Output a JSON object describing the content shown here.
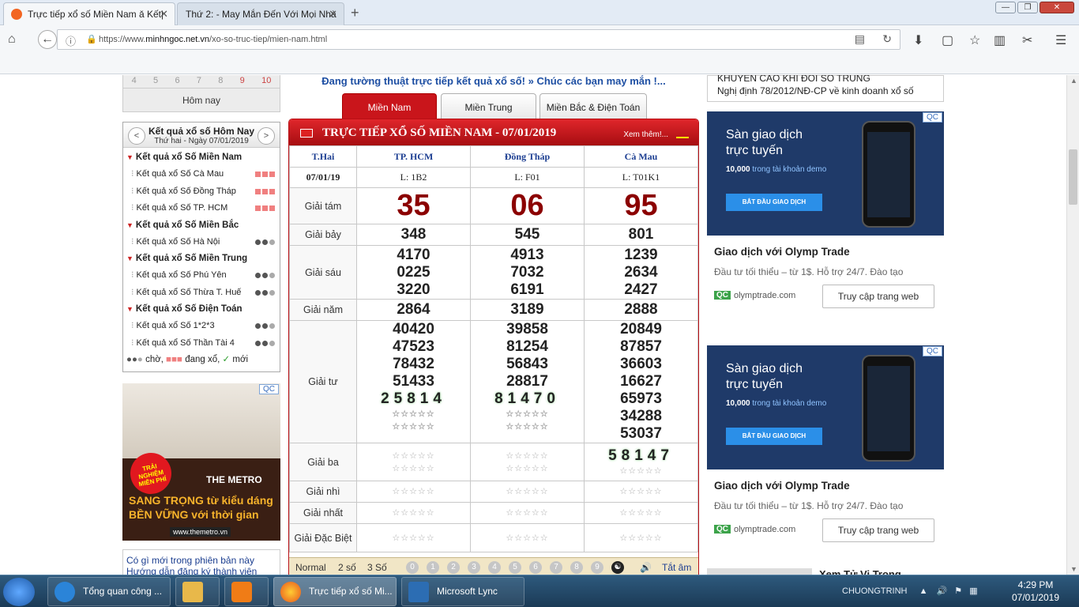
{
  "browser": {
    "tabs": [
      {
        "title": "Trực tiếp xổ số Miền Nam ǎ Kết|",
        "active": true
      },
      {
        "title": "Thứ 2: - May Mắn Đến Với Mọi Nhà",
        "active": false
      }
    ],
    "url_prefix": "https://www.",
    "url_domain": "minhngoc.net.vn",
    "url_path": "/xo-so-truc-tiep/mien-nam.html"
  },
  "left": {
    "calendar_row": [
      "4",
      "5",
      "6",
      "7",
      "8",
      "9",
      "10"
    ],
    "today_label": "Hôm nay",
    "results_title": "Kết quả xổ số Hôm Nay",
    "results_date": "Thứ hai - Ngày 07/01/2019",
    "groups": [
      {
        "title": "Kết quả xổ Số Miền Nam",
        "items": [
          {
            "label": "Kết quả xổ Số Cà Mau",
            "status": "dang-xo"
          },
          {
            "label": "Kết quả xổ Số Đồng Tháp",
            "status": "dang-xo"
          },
          {
            "label": "Kết quả xổ Số TP. HCM",
            "status": "dang-xo"
          }
        ]
      },
      {
        "title": "Kết quả xổ Số Miền Bắc",
        "items": [
          {
            "label": "Kết quả xổ Số Hà Nội",
            "status": "cho"
          }
        ]
      },
      {
        "title": "Kết quả xổ Số Miền Trung",
        "items": [
          {
            "label": "Kết quả xổ Số Phú Yên",
            "status": "cho"
          },
          {
            "label": "Kết quả xổ Số Thừa T. Huế",
            "status": "cho"
          }
        ]
      },
      {
        "title": "Kết quả xổ Số Điện Toán",
        "items": [
          {
            "label": "Kết quả xổ Số 1*2*3",
            "status": "cho"
          },
          {
            "label": "Kết quả xổ Số Thần Tài 4",
            "status": "cho"
          }
        ]
      }
    ],
    "legend_cho": "chờ,",
    "legend_dang": "đang xổ,",
    "legend_moi": "mới",
    "ad_qc": "QC",
    "ad_badge": "TRẢI NGHIỆM MIỄN PHÍ",
    "ad_brand": "THE METRO",
    "ad_line1": "SANG TRỌNG từ kiểu dáng",
    "ad_line2": "BỀN VỮNG với thời gian",
    "ad_web": "www.themetro.vn",
    "links": [
      "Có gì mới trong phiên bản này",
      "Hướng dẫn đăng ký thành viên"
    ]
  },
  "middle": {
    "marquee": "Đang tường thuật trực tiếp kết quả xổ số! » Chúc các bạn may mắn !...",
    "region_tabs": [
      "Miền Nam",
      "Miền Trung",
      "Miền Bắc & Điện Toán"
    ],
    "panel_title": "TRỰC TIẾP XỔ SỐ MIỀN NAM - 07/01/2019",
    "more": "Xem thêm!...",
    "day": "T.Hai",
    "date": "07/01/19",
    "provinces": [
      {
        "name": "TP. HCM",
        "code": "L: 1B2"
      },
      {
        "name": "Đồng Tháp",
        "code": "L: F01"
      },
      {
        "name": "Cà Mau",
        "code": "L: T01K1"
      }
    ],
    "prize_labels": {
      "g8": "Giải tám",
      "g7": "Giải bảy",
      "g6": "Giải sáu",
      "g5": "Giải năm",
      "g4": "Giải tư",
      "g3": "Giải ba",
      "g2": "Giải nhì",
      "g1": "Giải nhất",
      "db": "Giải Đặc Biệt"
    },
    "results": {
      "g8": [
        "35",
        "06",
        "95"
      ],
      "g7": [
        "348",
        "545",
        "801"
      ],
      "g6": [
        [
          "4170",
          "0225",
          "3220"
        ],
        [
          "4913",
          "7032",
          "6191"
        ],
        [
          "1239",
          "2634",
          "2427"
        ]
      ],
      "g5": [
        "2864",
        "3189",
        "2888"
      ],
      "g4": [
        [
          "40420",
          "47523",
          "78432",
          "51433"
        ],
        [
          "39858",
          "81254",
          "56843",
          "28817"
        ],
        [
          "20849",
          "87857",
          "36603",
          "16627",
          "65973",
          "34288",
          "53037"
        ]
      ],
      "g4_live": [
        "25814",
        "81470",
        ""
      ],
      "g3_live": [
        "",
        "",
        "58147"
      ]
    },
    "pending": "☆☆☆☆☆",
    "footer": {
      "normal": "Normal",
      "two": "2 số",
      "three": "3 Số",
      "digits": [
        "0",
        "1",
        "2",
        "3",
        "4",
        "5",
        "6",
        "7",
        "8",
        "9"
      ],
      "all": "Tắt âm"
    }
  },
  "right": {
    "links": [
      "KHUYẾN CÁO KHI ĐỔI SỐ TRÚNG",
      "Nghị định 78/2012/NĐ-CP về kinh doanh xổ số"
    ],
    "ad": {
      "qc": "QC",
      "head1": "Sàn giao dịch",
      "head2": "trực tuyến",
      "amount": "10,000",
      "amount_suffix": " trong tài khoản demo",
      "cta": "BẮT ĐẦU GIAO DỊCH",
      "title": "Giao dịch với Olymp Trade",
      "desc": "Đầu tư tối thiểu – từ 1$. Hỗ trợ 24/7. Đào tạo",
      "domain": "olymptrade.com",
      "button": "Truy cập trang web"
    },
    "teaser": "Xem Tử Vi Trọng..."
  },
  "taskbar": {
    "items": [
      "Tổng quan công ...",
      "",
      "",
      "Trực tiếp xổ số Mi...",
      "Microsoft Lync"
    ],
    "tray_label": "CHUONGTRINH",
    "time": "4:29 PM",
    "date": "07/01/2019"
  }
}
